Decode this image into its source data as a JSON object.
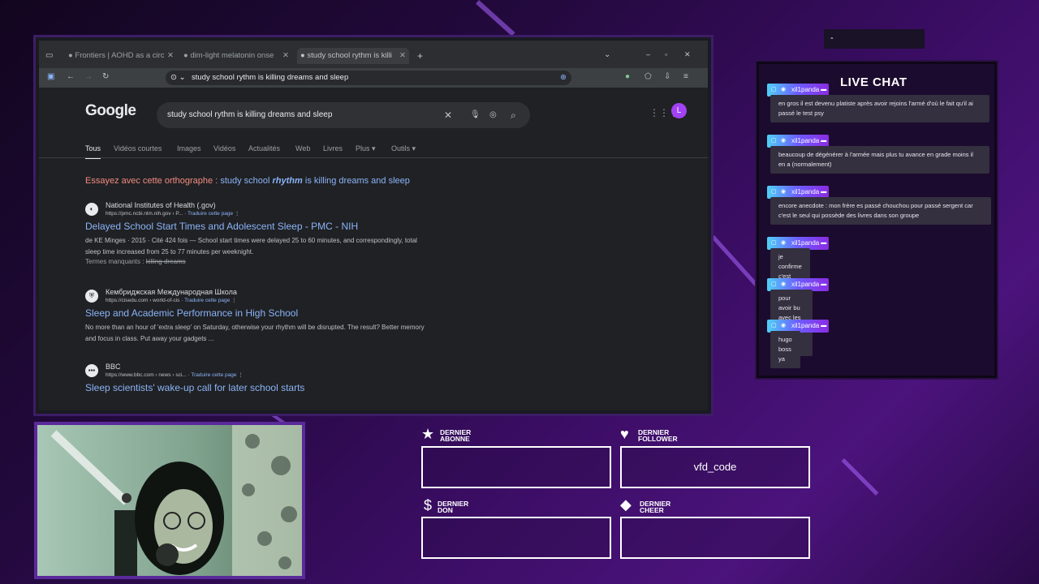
{
  "browser": {
    "tabs": [
      {
        "title": "Frontiers | AOHD as a circ",
        "active": false
      },
      {
        "title": "dim-light melatonin onse",
        "active": false
      },
      {
        "title": "study school rythm is killi",
        "active": true
      }
    ],
    "address": "study school rythm is killing dreams and sleep",
    "window_controls": {
      "minimize": "–",
      "maximize": "▫",
      "close": "✕"
    }
  },
  "google": {
    "logo": "Google",
    "query": "study school rythm is killing dreams and sleep",
    "avatar_letter": "L",
    "nav_tabs": [
      "Tous",
      "Vidéos courtes",
      "Images",
      "Vidéos",
      "Actualités",
      "Web",
      "Livres",
      "Plus ▾",
      "Outils ▾"
    ],
    "suggestion": {
      "prefix": "Essayez avec cette orthographe :",
      "pre": " study school ",
      "corr": "rhythm",
      "post": " is killing dreams and sleep"
    },
    "results": [
      {
        "site": "National Institutes of Health (.gov)",
        "url": "https://pmc.ncbi.nlm.nih.gov › P...",
        "translate": "Traduire cette page",
        "title": "Delayed School Start Times and Adolescent Sleep - PMC - NIH",
        "snippet": "de KE Minges · 2015 · Cité 424 fois — School start times were delayed 25 to 60 minutes, and correspondingly, total sleep time increased from 25 to 77 minutes per weeknight.",
        "missing_label": "Termes manquants :",
        "missing": "killing dreams"
      },
      {
        "site": "Кембриджская Международная Школа",
        "url": "https://cisedu.com › world-of-cis",
        "translate": "Traduire cette page",
        "title": "Sleep and Academic Performance in High School",
        "snippet": "No more than an hour of 'extra sleep' on Saturday, otherwise your rhythm will be disrupted. The result? Better memory and focus in class. Put away your gadgets ..."
      },
      {
        "site": "BBC",
        "url": "https://www.bbc.com › news › sci...",
        "translate": "Traduire cette page",
        "title": "Sleep scientists' wake-up call for later school starts"
      }
    ]
  },
  "chat": {
    "title": "LIVE CHAT",
    "top_box": "-",
    "messages": [
      {
        "user": "xil1panda",
        "text": "en gros il est devenu platiste après avoir rejoins l'armé d'où le fait qu'il ai passé le test psy"
      },
      {
        "user": "xil1panda",
        "text": "beaucoup de dégénérer à l'armée mais plus tu avance en grade moins il en a (normalement)"
      },
      {
        "user": "xil1panda",
        "text": "encore anecdote : mon frère es passé chouchou pour passé sergent car c'est le seul qui possède des livres dans son groupe"
      },
      {
        "user": "xil1panda",
        "text": "je confirme c'est des monkey"
      },
      {
        "user": "xil1panda",
        "text": "pour avoir bu avec les collègues de mon reuf"
      },
      {
        "user": "xil1panda",
        "text": "hugo boss ya"
      }
    ]
  },
  "stats": {
    "abonne": {
      "line1": "DERNIER",
      "line2": "ABONNE",
      "value": ""
    },
    "follower": {
      "line1": "DERNIER",
      "line2": "FOLLOWER",
      "value": "vfd_code"
    },
    "don": {
      "line1": "DERNIER",
      "line2": "DON",
      "value": ""
    },
    "cheer": {
      "line1": "DERNIER",
      "line2": "CHEER",
      "value": ""
    }
  }
}
